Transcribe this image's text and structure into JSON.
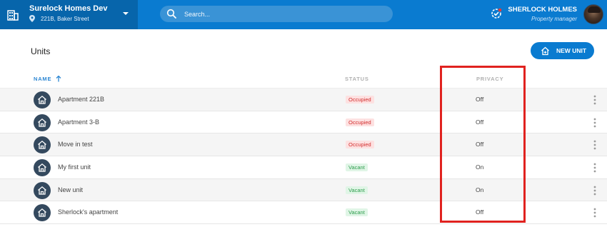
{
  "header": {
    "property_name": "Surelock Homes Dev",
    "property_address": "221B, Baker Street",
    "search_placeholder": "Search...",
    "user_name": "SHERLOCK HOLMES",
    "user_role": "Property manager"
  },
  "page": {
    "title": "Units",
    "new_unit_label": "NEW UNIT"
  },
  "table": {
    "columns": {
      "name": "NAME",
      "status": "STATUS",
      "privacy": "PRIVACY"
    },
    "sort": {
      "column": "name",
      "direction": "ascending"
    },
    "rows": [
      {
        "name": "Apartment 221B",
        "status": "Occupied",
        "privacy": "Off"
      },
      {
        "name": "Apartment 3-B",
        "status": "Occupied",
        "privacy": "Off"
      },
      {
        "name": "Move in test",
        "status": "Occupied",
        "privacy": "Off"
      },
      {
        "name": "My first unit",
        "status": "Vacant",
        "privacy": "On"
      },
      {
        "name": "New unit",
        "status": "Vacant",
        "privacy": "On"
      },
      {
        "name": "Sherlock's apartment",
        "status": "Vacant",
        "privacy": "Off"
      }
    ]
  },
  "icons": {
    "building": "building-icon",
    "pin": "location-pin-icon",
    "chevron": "chevron-down-icon",
    "search": "search-icon",
    "notification": "badge-check-icon",
    "new_unit": "home-plus-icon",
    "sort": "arrow-up-icon",
    "unit": "home-icon",
    "more": "more-vertical-icon"
  },
  "colors": {
    "topbar": "#0a7bd0",
    "topbar_left": "#0765ab",
    "accent": "#0a7bd0",
    "occupied_bg": "#fde1e1",
    "occupied_text": "#d32f2f",
    "vacant_bg": "#e0f5e6",
    "vacant_text": "#2e9d4d",
    "highlight": "#e0221f"
  }
}
